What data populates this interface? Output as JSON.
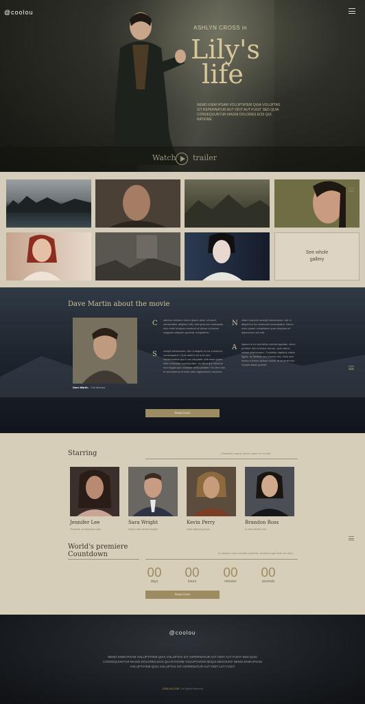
{
  "brand": {
    "logo": "@coolou"
  },
  "hero": {
    "presents": "ASHLYN CROSS in",
    "title_line1": "Lily's",
    "title_line2": "life",
    "credits": "NEMO ENIM IPSAM VOLUPTATEM QUIA VOLUPTAS SIT ASPERNATUR AUT ODIT AUT FUGIT SED QUIA CONSEQUUNTUR MAGNI DOLORES EOS QUI RATIONE",
    "watch": "Watch",
    "trailer": "trailer"
  },
  "gallery": {
    "see_line1": "See whole",
    "see_line2": "gallery"
  },
  "director": {
    "heading": "Dave Martin about the movie",
    "caption_name": "Dave Martin",
    "caption_role": " - The director",
    "cap1": "C",
    "cap2": "S",
    "cap3": "N",
    "cap4": "A",
    "text1": "ollentur dolorem lorem ipsum dolor sit amet, consectetur adipisci velit, sed quia non numquam eius modi tempora incidunt ut labore et dolore magnam aliquam quaerat voluptatem.",
    "text2": "uscipit laboriosam, nisi ut aliquid ex ea commodi consequatur? Quis autem vel eum iure reprehenderit qui in ea voluptate velit esse quam nihil molestiae consequatur, vel illum qui dolorem eum fugiat quo voluptas nulla pariatur? At vero eos et accusamus et iusto odio dignissimos ducimus.",
    "text3": "ullam corporis suscipit laboriosam, nisi ut aliquid ex ea commodi consequatur. Nemo enim ipsam voluptatem quia voluptas sit aspernatur aut odit.",
    "text4": "liquam in mi sed tellus lacinia egestas. Nunc pretium nisi ut lectus rutrum, quis varius metus ullamcorper. Curabitur dapibus varius ligula, ac facilisis orci viverra nec. Duis sed lectus a lectus dictum auctor at sit amet nisi. Suspendisse potenti.",
    "read_more": "Read more"
  },
  "starring": {
    "title": "Starring",
    "note": "Phasellus mauris dictum diam vel ut velit.",
    "actors": [
      {
        "name": "Jennifer Lee",
        "role": "Phasellus vel bibendum justo"
      },
      {
        "name": "Sara Wright",
        "role": "Nullam vitae dictum fringilla"
      },
      {
        "name": "Kevin Perry",
        "role": "Vitae adipiscing turpis"
      },
      {
        "name": "Brandon Ross",
        "role": "In vitae efficitur velit"
      }
    ]
  },
  "countdown": {
    "title_line1": "World's premiere",
    "title_line2": "Countdown",
    "note": "In dapibus nunc lobortis pharetra, tincidunt eget ante vel dolor.",
    "units": [
      {
        "value": "00",
        "label": "days"
      },
      {
        "value": "00",
        "label": "hours"
      },
      {
        "value": "00",
        "label": "minutes"
      },
      {
        "value": "00",
        "label": "seconds"
      }
    ],
    "read_more": "Read more"
  },
  "footer": {
    "logo": "@coolou",
    "credits": "NEMO ENIM IPSAM VOLUPTATEM QUIA VOLUPTAS SIT ASPERNATUR AUT ODIT AUT FUGIT SED QUIA CONSEQUUNTUR MAGNI DOLORES EOS QUI RATIONE VOLUPTATEM SEQUI NESCIUNT NEMO ENIM IPSAM VOLUPTATEM QUIA VOLUPTAS SIT ASPERNATUR AUT ODIT AUT FUGIT",
    "copyright_brand": "COOLOU.COM",
    "copyright_rest": " © All Rights Reserved"
  },
  "colors": {
    "accent": "#9d8b62",
    "gold_text": "#d3c49a",
    "paper": "#d7ceba"
  }
}
